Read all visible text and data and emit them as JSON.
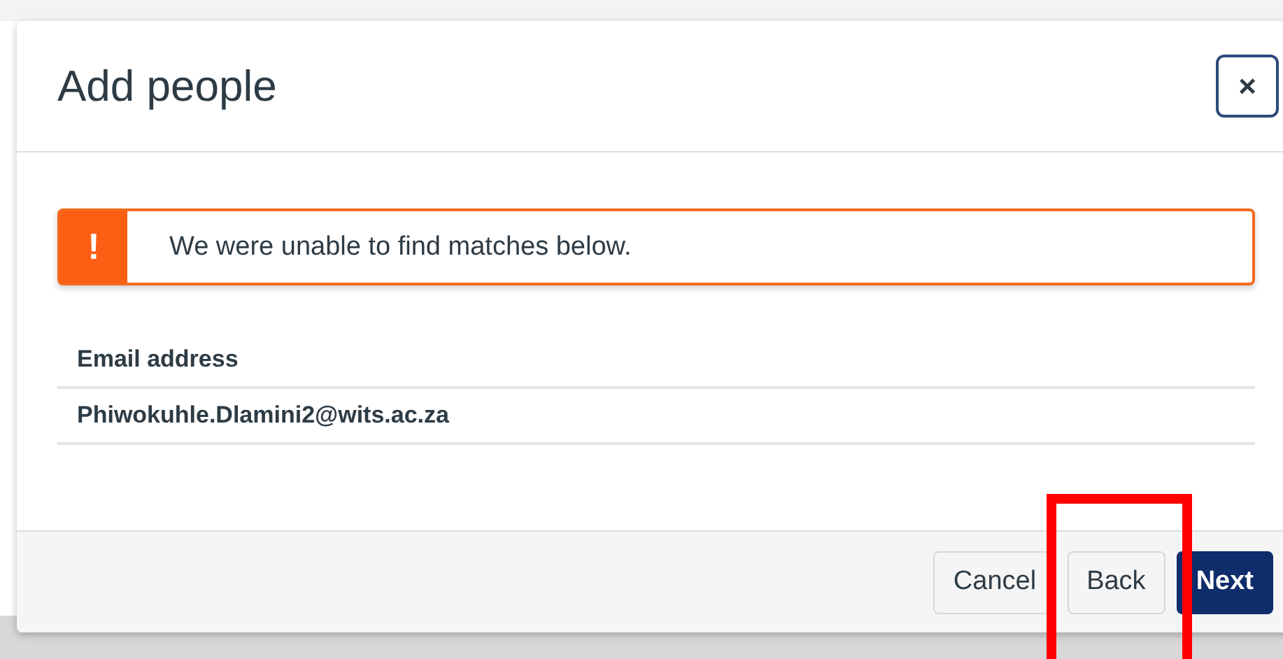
{
  "dialog": {
    "title": "Add people",
    "close_label": "×"
  },
  "alert": {
    "icon": "!",
    "message": "We were unable to find matches below."
  },
  "table": {
    "columns": [
      "Email address"
    ],
    "rows": [
      [
        "Phiwokuhle.Dlamini2@wits.ac.za"
      ]
    ]
  },
  "buttons": [
    {
      "label": "Cancel",
      "kind": "secondary"
    },
    {
      "label": "Back",
      "kind": "secondary"
    },
    {
      "label": "Next",
      "kind": "primary"
    }
  ]
}
